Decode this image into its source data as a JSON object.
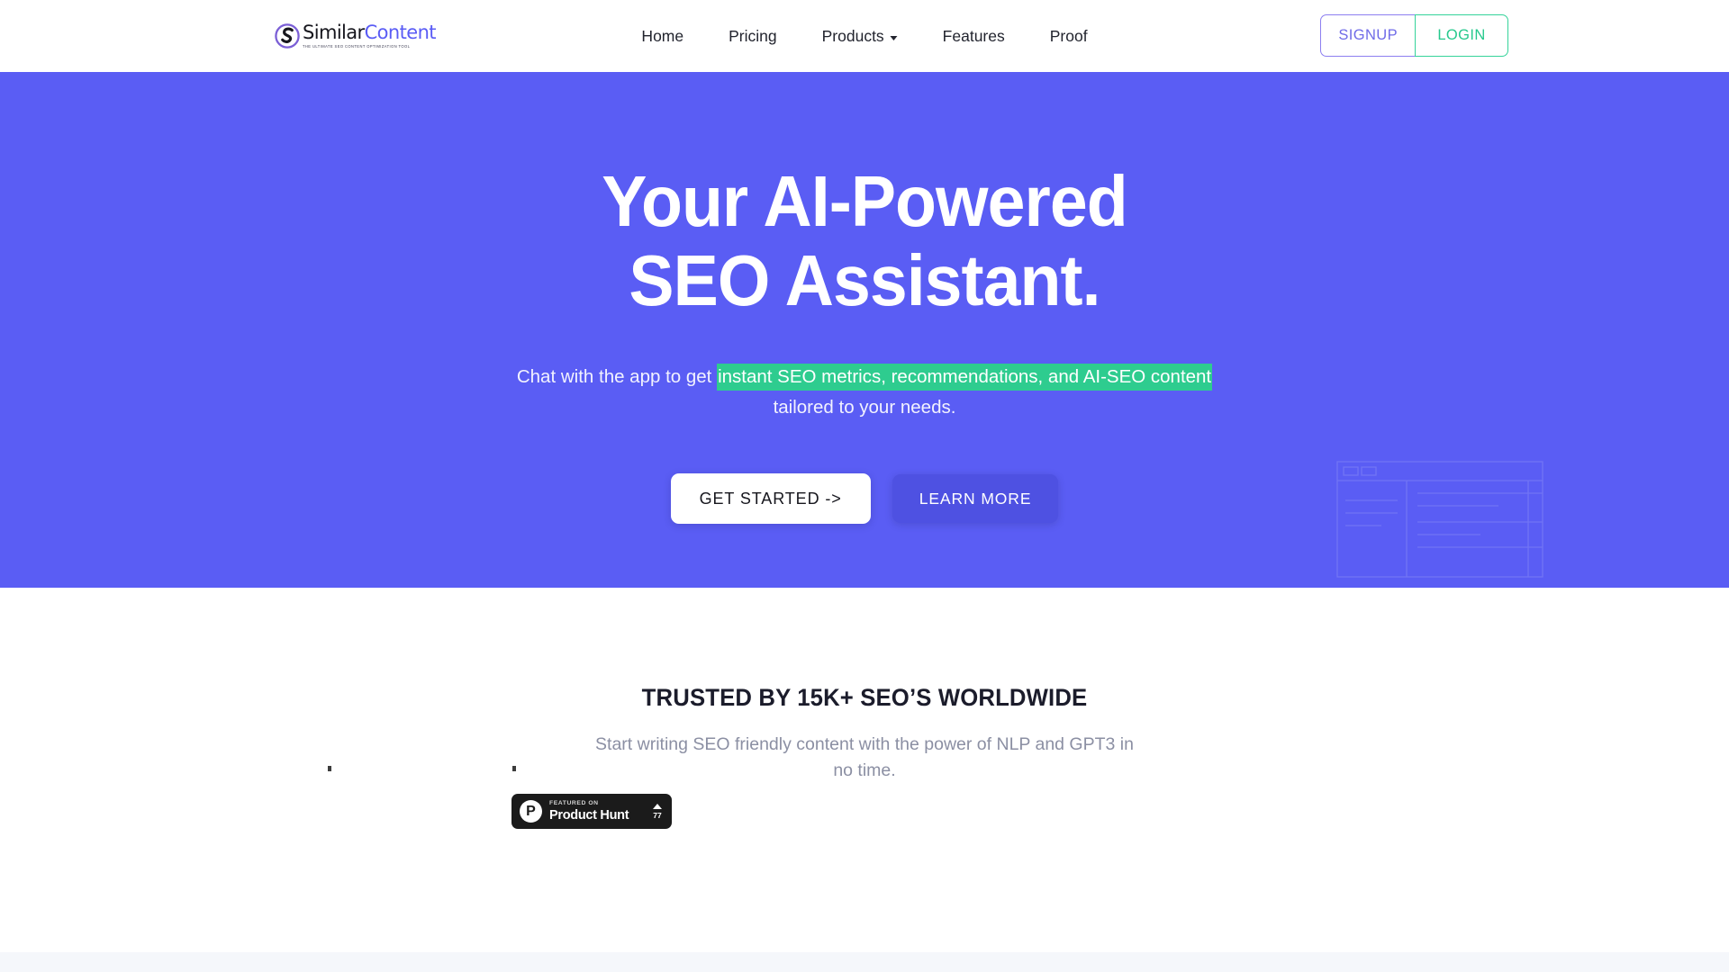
{
  "brand": {
    "name_part1": "Similar",
    "name_part2": "Content",
    "tagline": "THE ULTIMATE SEO CONTENT OPTIMIZATION TOOL",
    "mark_letter": "S",
    "accent_purple": "#5a5cf5",
    "accent_green": "#2ecc8f"
  },
  "nav": {
    "links": [
      {
        "label": "Home",
        "has_dropdown": false
      },
      {
        "label": "Pricing",
        "has_dropdown": false
      },
      {
        "label": "Products",
        "has_dropdown": true
      },
      {
        "label": "Features",
        "has_dropdown": false
      },
      {
        "label": "Proof",
        "has_dropdown": false
      }
    ],
    "signup_label": "SIGNUP",
    "login_label": "LOGIN",
    "signup_color": "#6f6be8",
    "login_color": "#26c98d"
  },
  "hero": {
    "background_color": "#5a5df4",
    "title_line1": "Your AI-Powered SEO",
    "title_line2": "Assistant.",
    "subtitle_before": "Chat with the app to get ",
    "subtitle_highlight": "instant SEO metrics, recommendations, and AI-SEO content",
    "subtitle_after": " tailored to your needs.",
    "highlight_color": "#2ecc8f",
    "cta_primary": "GET STARTED  ->",
    "cta_secondary": "LEARN MORE"
  },
  "trusted": {
    "title": "TRUSTED BY 15K+ SEO’S WORLDWIDE",
    "subtitle": "Start writing SEO friendly content with the power of NLP and GPT3 in no time."
  },
  "product_hunt": {
    "featured_label": "FEATURED ON",
    "name": "Product Hunt",
    "upvotes": "77"
  }
}
